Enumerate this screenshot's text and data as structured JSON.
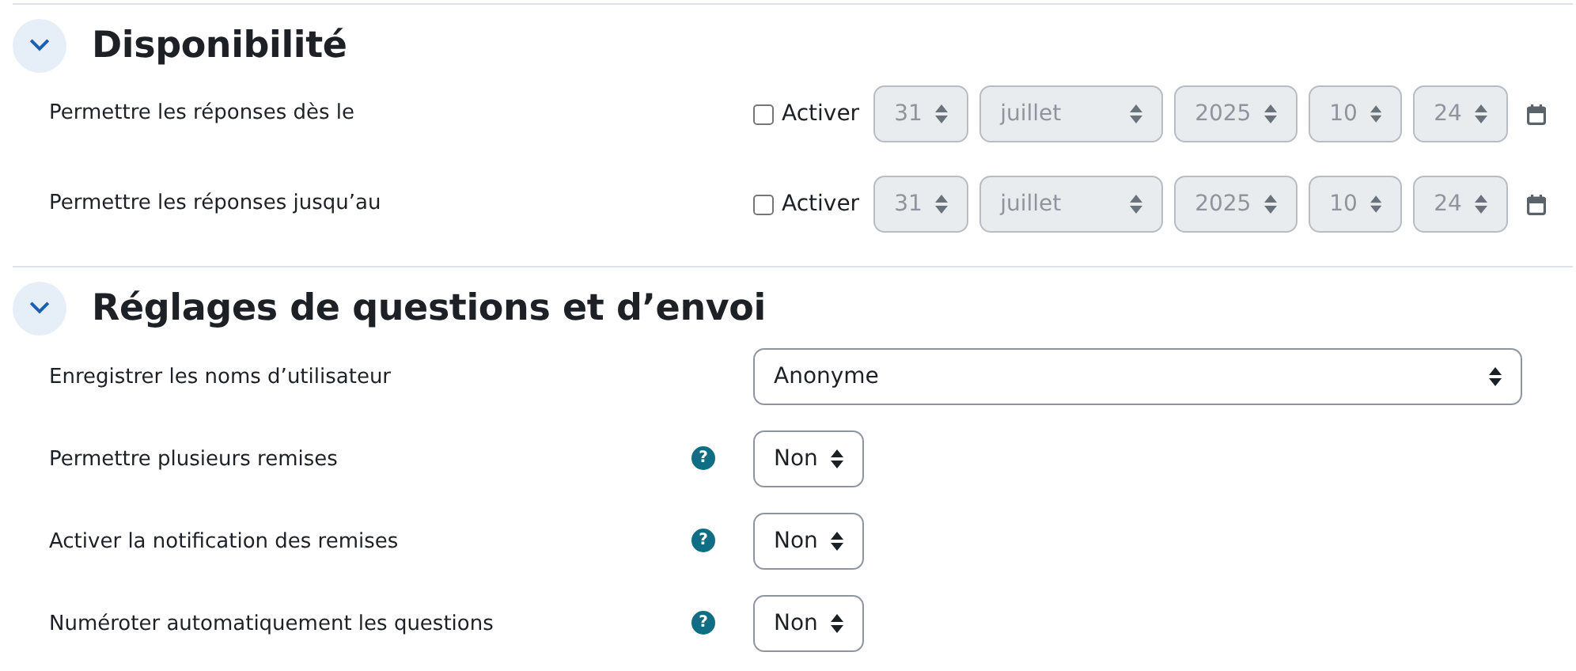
{
  "sections": [
    {
      "title": "Disponibilité",
      "expanded": true,
      "rows": [
        {
          "kind": "datetime",
          "label": "Permettre les réponses dès le",
          "checked": false,
          "checkbox_label": "Activer",
          "fields": [
            "31",
            "juillet",
            "2025",
            "10",
            "24"
          ]
        },
        {
          "kind": "datetime",
          "label": "Permettre les réponses jusqu’au",
          "checked": false,
          "checkbox_label": "Activer",
          "fields": [
            "31",
            "juillet",
            "2025",
            "10",
            "24"
          ]
        }
      ]
    },
    {
      "title": "Réglages de questions et d’envoi",
      "expanded": true,
      "rows": [
        {
          "kind": "select",
          "label": "Enregistrer les noms d’utilisateur",
          "value": "Anonyme",
          "wide": true
        },
        {
          "kind": "select",
          "label": "Permettre plusieurs remises",
          "help": "?",
          "value": "Non",
          "wide": false
        },
        {
          "kind": "select",
          "label": "Activer la notification des remises",
          "help": "?",
          "value": "Non",
          "wide": false
        },
        {
          "kind": "select",
          "label": "Numéroter automatiquement les questions",
          "help": "?",
          "value": "Non",
          "wide": false
        }
      ]
    }
  ]
}
